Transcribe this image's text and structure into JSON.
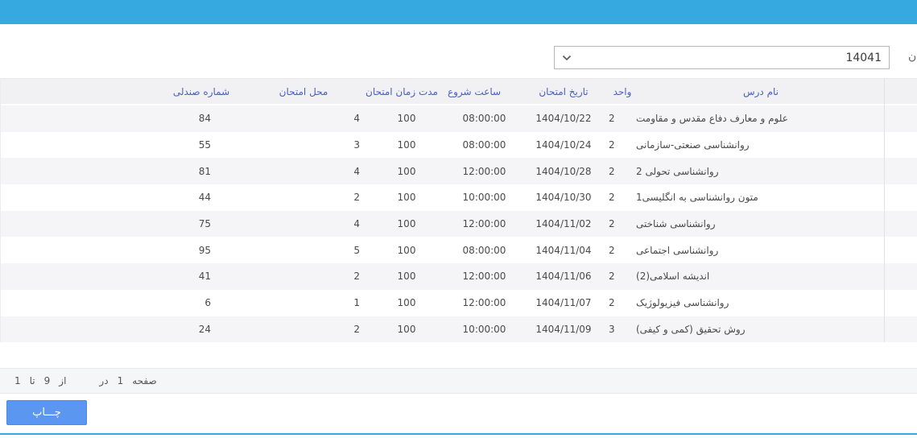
{
  "colors": {
    "topbar": "#36a9e1",
    "header_text": "#4a5fc0",
    "stripe": "#f5f5f7",
    "button": "#5b97f0",
    "bottom_line": "#36a9e1"
  },
  "term_selector": {
    "value": "14041",
    "label_fragment": "ن"
  },
  "table": {
    "columns": [
      {
        "key": "course",
        "label": "نام درس"
      },
      {
        "key": "units",
        "label": "واحد"
      },
      {
        "key": "date",
        "label": "تاریخ امتحان"
      },
      {
        "key": "start",
        "label": "ساعت شروع"
      },
      {
        "key": "duration",
        "label": "مدت زمان امتحان"
      },
      {
        "key": "location",
        "label": "محل امتحان"
      },
      {
        "key": "seat",
        "label": "شماره صندلی"
      }
    ],
    "rows": [
      {
        "course": "علوم و معارف دفاع مقدس و مقاومت",
        "units": "2",
        "date": "1404/10/22",
        "start": "08:00:00",
        "duration": "100",
        "location": "4",
        "seat": "84"
      },
      {
        "course": "روانشناسی صنعتی-سازمانی",
        "units": "2",
        "date": "1404/10/24",
        "start": "08:00:00",
        "duration": "100",
        "location": "3",
        "seat": "55"
      },
      {
        "course": "روانشناسی تحولی 2",
        "units": "2",
        "date": "1404/10/28",
        "start": "12:00:00",
        "duration": "100",
        "location": "4",
        "seat": "81"
      },
      {
        "course": "متون روانشناسی به انگلیسی1",
        "units": "2",
        "date": "1404/10/30",
        "start": "10:00:00",
        "duration": "100",
        "location": "2",
        "seat": "44"
      },
      {
        "course": "روانشناسی شناختی",
        "units": "2",
        "date": "1404/11/02",
        "start": "12:00:00",
        "duration": "100",
        "location": "4",
        "seat": "75"
      },
      {
        "course": "روانشناسی اجتماعی",
        "units": "2",
        "date": "1404/11/04",
        "start": "08:00:00",
        "duration": "100",
        "location": "5",
        "seat": "95"
      },
      {
        "course": "اندیشه اسلامی(2)",
        "units": "2",
        "date": "1404/11/06",
        "start": "12:00:00",
        "duration": "100",
        "location": "2",
        "seat": "41"
      },
      {
        "course": "روانشناسی فیزیولوژیک",
        "units": "2",
        "date": "1404/11/07",
        "start": "12:00:00",
        "duration": "100",
        "location": "1",
        "seat": "6"
      },
      {
        "course": "روش تحقیق (کمی و کیفی)",
        "units": "3",
        "date": "1404/11/09",
        "start": "10:00:00",
        "duration": "100",
        "location": "2",
        "seat": "24"
      }
    ]
  },
  "pager": {
    "tokens": [
      "1",
      "تا",
      "9",
      "از",
      "در",
      "1",
      "صفحه"
    ]
  },
  "print_button": {
    "label": "چـــاپ"
  }
}
